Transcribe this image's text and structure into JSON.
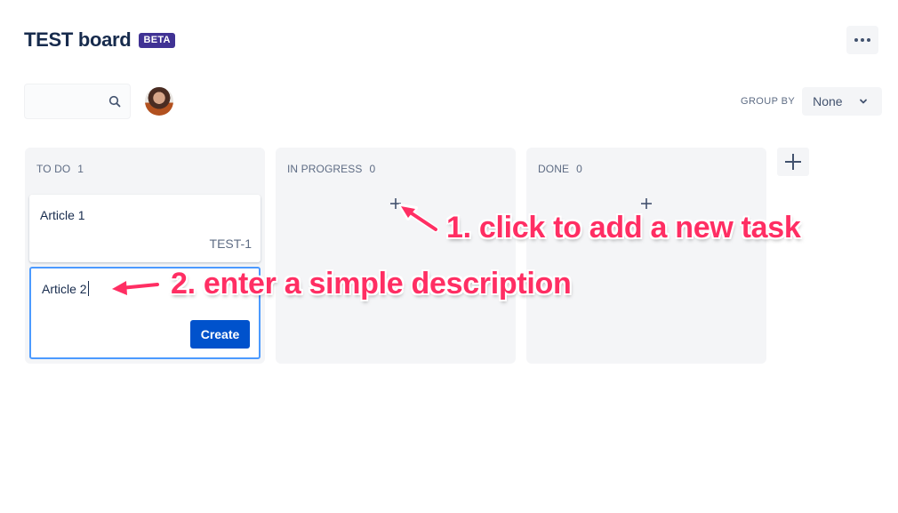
{
  "header": {
    "title": "TEST board",
    "badge": "BETA",
    "more_icon": "more-horizontal-icon"
  },
  "toolbar": {
    "search": {
      "value": "",
      "placeholder": "",
      "icon": "search-icon"
    },
    "avatar": "user-avatar",
    "group_by": {
      "label": "GROUP BY",
      "selected": "None",
      "icon": "chevron-down-icon"
    }
  },
  "columns": [
    {
      "name": "TO DO",
      "count": "1",
      "cards": [
        {
          "title": "Article 1",
          "key": "TEST-1"
        }
      ],
      "create_form": {
        "value": "Article 2",
        "button": "Create"
      }
    },
    {
      "name": "IN PROGRESS",
      "count": "0",
      "add_icon": "plus-icon"
    },
    {
      "name": "DONE",
      "count": "0",
      "add_icon": "plus-icon"
    }
  ],
  "add_column_icon": "plus-icon",
  "annotations": [
    {
      "text": "1. click to add a new task",
      "color": "#ff2e63"
    },
    {
      "text": "2. enter a simple description",
      "color": "#ff2e63"
    }
  ],
  "colors": {
    "primary_button": "#0052cc",
    "badge": "#403294",
    "column_bg": "#f4f5f7",
    "focus_border": "#4c9aff",
    "annotation": "#ff2e63"
  }
}
